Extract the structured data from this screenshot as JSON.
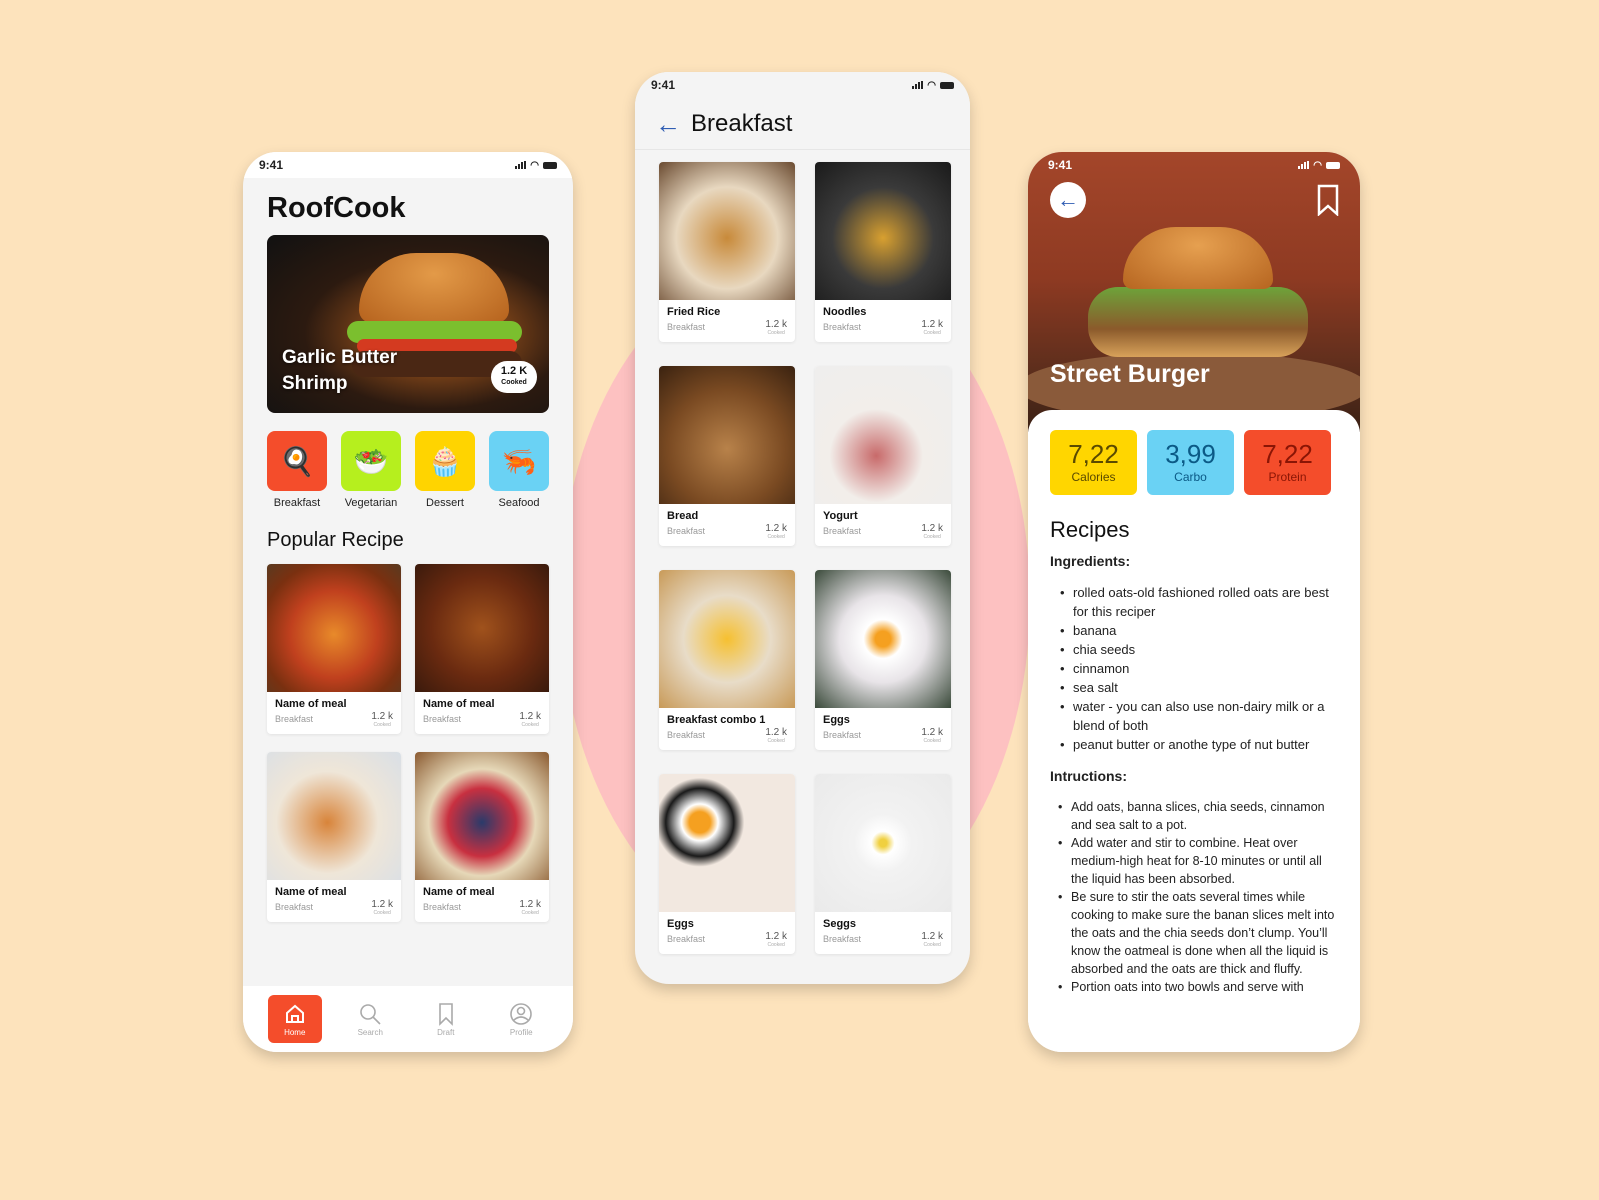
{
  "status_time": "9:41",
  "home": {
    "app_title": "RoofCook",
    "hero": {
      "title_line1": "Garlic Butter",
      "title_line2": "Shrimp",
      "count": "1.2 K",
      "count_label": "Cooked"
    },
    "categories": [
      {
        "label": "Breakfast",
        "icon": "🍳",
        "color": "#f44d2b"
      },
      {
        "label": "Vegetarian",
        "icon": "🥗",
        "color": "#b6ef1e"
      },
      {
        "label": "Dessert",
        "icon": "🧁",
        "color": "#ffd400"
      },
      {
        "label": "Seafood",
        "icon": "🦐",
        "color": "#6ad2f4"
      }
    ],
    "section_title": "Popular Recipe",
    "recipes": [
      {
        "name": "Name of meal",
        "category": "Breakfast",
        "count": "1.2 k",
        "count_label": "Cooked"
      },
      {
        "name": "Name of meal",
        "category": "Breakfast",
        "count": "1.2 k",
        "count_label": "Cooked"
      },
      {
        "name": "Name of meal",
        "category": "Breakfast",
        "count": "1.2 k",
        "count_label": "Cooked"
      },
      {
        "name": "Name of meal",
        "category": "Breakfast",
        "count": "1.2 k",
        "count_label": "Cooked"
      }
    ],
    "tabs": [
      {
        "label": "Home",
        "icon": "home-icon",
        "active": true
      },
      {
        "label": "Search",
        "icon": "search-icon"
      },
      {
        "label": "Draft",
        "icon": "bookmark-icon"
      },
      {
        "label": "Profile",
        "icon": "profile-icon"
      }
    ]
  },
  "breakfast": {
    "title": "Breakfast",
    "items": [
      {
        "name": "Fried Rice",
        "category": "Breakfast",
        "count": "1.2 k",
        "count_label": "Cooked"
      },
      {
        "name": "Noodles",
        "category": "Breakfast",
        "count": "1.2 k",
        "count_label": "Cooked"
      },
      {
        "name": "Bread",
        "category": "Breakfast",
        "count": "1.2 k",
        "count_label": "Cooked"
      },
      {
        "name": "Yogurt",
        "category": "Breakfast",
        "count": "1.2 k",
        "count_label": "Cooked"
      },
      {
        "name": "Breakfast combo 1",
        "category": "Breakfast",
        "count": "1.2 k",
        "count_label": "Cooked"
      },
      {
        "name": "Eggs",
        "category": "Breakfast",
        "count": "1.2 k",
        "count_label": "Cooked"
      },
      {
        "name": "Eggs",
        "category": "Breakfast",
        "count": "1.2 k",
        "count_label": "Cooked"
      },
      {
        "name": "Seggs",
        "category": "Breakfast",
        "count": "1.2 k",
        "count_label": "Cooked"
      }
    ]
  },
  "detail": {
    "title": "Street Burger",
    "stats": [
      {
        "value": "7,22",
        "label": "Calories",
        "bg": "#ffd600",
        "fg": "#5a4a00"
      },
      {
        "value": "3,99",
        "label": "Carbo",
        "bg": "#6ad2f4",
        "fg": "#0b5a86"
      },
      {
        "value": "7,22",
        "label": "Protein",
        "bg": "#f44d2b",
        "fg": "#8a1505"
      }
    ],
    "recipes_title": "Recipes",
    "ingredients_title": "Ingredients:",
    "ingredients": [
      "rolled oats-old fashioned rolled oats are best for this reciper",
      "banana",
      "chia seeds",
      "cinnamon",
      "sea salt",
      "water - you can also use non-dairy milk or a blend of both",
      "peanut butter or anothe type of nut butter"
    ],
    "instructions_title": "Intructions:",
    "instructions": [
      "Add oats, banna slices, chia seeds, cinnamon and sea salt to a pot.",
      "Add water and stir to combine. Heat over medium-high heat for 8-10 minutes or until all the liquid has been absorbed.",
      "Be sure to stir the oats several times while cooking to make sure the banan slices melt into the oats and the chia seeds don’t clump. You’ll know the oatmeal is done when all the liquid is absorbed and the oats are thick and fluffy.",
      "Portion oats into two bowls and serve with"
    ]
  }
}
